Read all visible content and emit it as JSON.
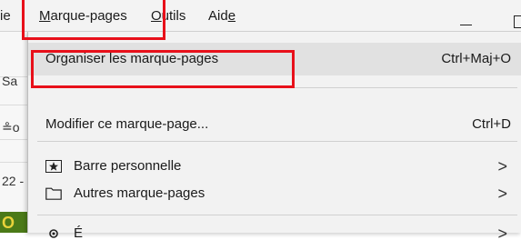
{
  "menubar": {
    "partial_left": "ie",
    "bookmarks": {
      "accel": "M",
      "rest": "arque-pages"
    },
    "tools": {
      "accel": "O",
      "rest": "utils"
    },
    "help": {
      "text": "Aid",
      "accel": "e"
    }
  },
  "behind": {
    "frag_sa": "Sa",
    "frag_mail": "≗o",
    "frag_date": "22 -",
    "frag_green": "O"
  },
  "menu": {
    "items": [
      {
        "label": "Organiser les marque-pages",
        "shortcut": "Ctrl+Maj+O",
        "highlighted": true
      },
      {
        "label": "Modifier ce marque-page...",
        "shortcut": "Ctrl+D"
      },
      {
        "label": "Barre personnelle",
        "icon": "star-toolbar-icon",
        "submenu_arrow": ">"
      },
      {
        "label": "Autres marque-pages",
        "icon": "folder-icon",
        "submenu_arrow": ">"
      },
      {
        "label": "É",
        "icon": "gear-icon",
        "submenu_arrow": ">"
      }
    ]
  },
  "colors": {
    "highlight_box": "#e8101a",
    "menu_background": "#f2f2f2",
    "hover_row": "#e1e1e1"
  }
}
